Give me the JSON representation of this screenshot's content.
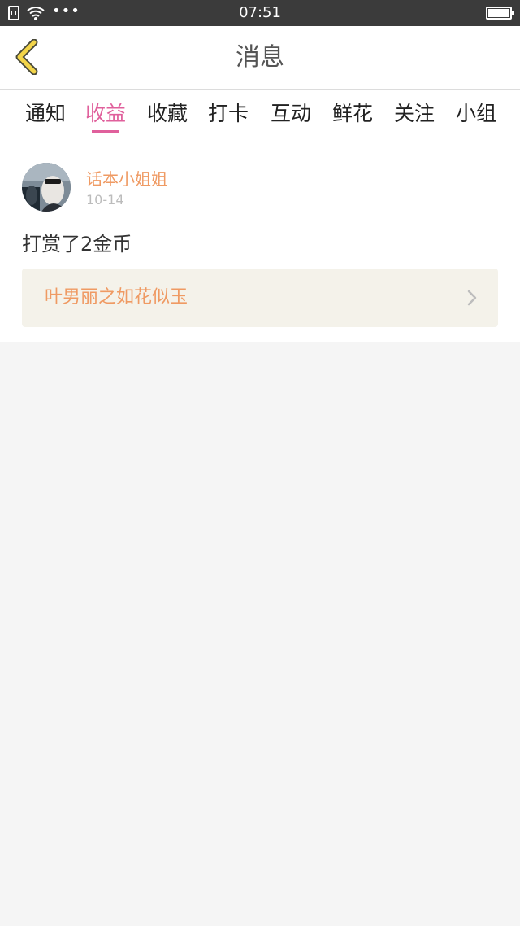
{
  "status_bar": {
    "time": "07:51",
    "icons": [
      "sim-icon",
      "wifi-icon",
      "more-dots-icon",
      "battery-icon"
    ]
  },
  "header": {
    "title": "消息",
    "back_icon": "chevron-left-icon"
  },
  "tabs": [
    {
      "label": "通知",
      "active": false
    },
    {
      "label": "收益",
      "active": true
    },
    {
      "label": "收藏",
      "active": false
    },
    {
      "label": "打卡",
      "active": false
    },
    {
      "label": "互动",
      "active": false
    },
    {
      "label": "鲜花",
      "active": false
    },
    {
      "label": "关注",
      "active": false
    },
    {
      "label": "小组",
      "active": false
    }
  ],
  "notification": {
    "username": "话本小姐姐",
    "date": "10-14",
    "message": "打赏了2金币",
    "book_title": "叶男丽之如花似玉"
  },
  "colors": {
    "accent": "#e0609c",
    "orange": "#ef9a63",
    "back_icon": "#f3d54a",
    "card_bg": "#f4f2ea"
  }
}
